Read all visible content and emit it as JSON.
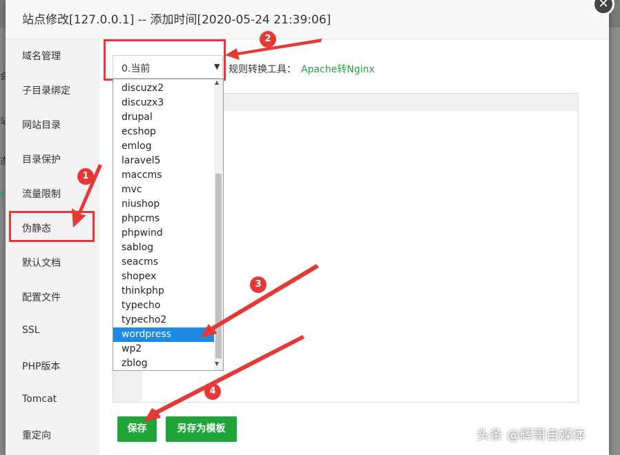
{
  "dialog": {
    "title": "站点修改[127.0.0.1] -- 添加时间[2020-05-24 21:39:06]",
    "close_icon": "close-icon"
  },
  "background_fragments": [
    "会",
    "站",
    "态",
    "行"
  ],
  "sidebar": {
    "items": [
      {
        "label": "域名管理"
      },
      {
        "label": "子目录绑定"
      },
      {
        "label": "网站目录"
      },
      {
        "label": "目录保护"
      },
      {
        "label": "流量限制"
      },
      {
        "label": "伪静态"
      },
      {
        "label": "默认文档"
      },
      {
        "label": "配置文件"
      },
      {
        "label": "SSL"
      },
      {
        "label": "PHP版本"
      },
      {
        "label": "Tomcat"
      },
      {
        "label": "重定向"
      }
    ],
    "active": "伪静态"
  },
  "rewrite": {
    "select_value": "0.当前",
    "tool_label": "规则转换工具：",
    "tool_link": "Apache转Nginx"
  },
  "dropdown": {
    "options": [
      "discuzx2",
      "discuzx3",
      "drupal",
      "ecshop",
      "emlog",
      "laravel5",
      "maccms",
      "mvc",
      "niushop",
      "phpcms",
      "phpwind",
      "sablog",
      "seacms",
      "shopex",
      "thinkphp",
      "typecho",
      "typecho2",
      "wordpress",
      "wp2",
      "zblog"
    ],
    "selected": "wordpress"
  },
  "buttons": {
    "save": "保存",
    "save_as_template": "另存为模板"
  },
  "annotations": [
    "1",
    "2",
    "3",
    "4"
  ],
  "watermark": "头条 @辉哥自媒体",
  "colors": {
    "accent_green": "#20a53a",
    "annotation_red": "#e53935",
    "selection_blue": "#1e88e5"
  }
}
